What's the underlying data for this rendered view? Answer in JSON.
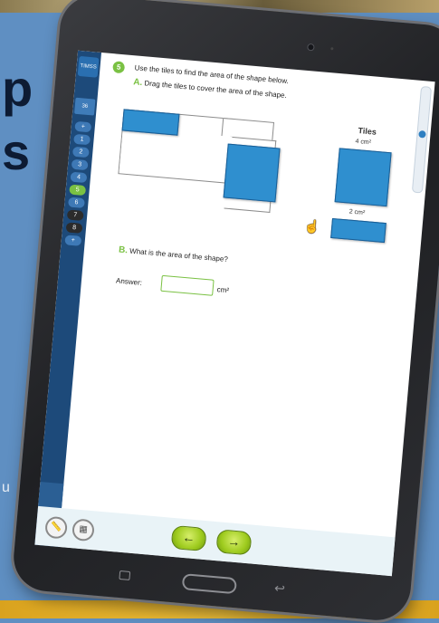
{
  "background": {
    "text_fragment_1": "p",
    "text_fragment_2": "s",
    "text_fragment_3": "u"
  },
  "sidebar": {
    "logo_text": "TIMSS",
    "logo2_text": "36",
    "items": [
      {
        "label": "+"
      },
      {
        "label": "1"
      },
      {
        "label": "2"
      },
      {
        "label": "3"
      },
      {
        "label": "4"
      },
      {
        "label": "5",
        "active": true
      },
      {
        "label": "6"
      },
      {
        "label": "7"
      },
      {
        "label": "8"
      },
      {
        "label": "+"
      }
    ]
  },
  "question": {
    "number": "5",
    "prompt": "Use the tiles to find the area of the shape below.",
    "part_a_letter": "A.",
    "part_a_text": "Drag the tiles to cover the area of the shape.",
    "tiles_title": "Tiles",
    "tile_large_label": "4 cm²",
    "tile_small_label": "2 cm²",
    "part_b_letter": "B.",
    "part_b_text": "What is the area of the shape?",
    "answer_label": "Answer:",
    "answer_value": "",
    "answer_unit": "cm²"
  },
  "footer": {
    "ruler_icon": "ruler-icon",
    "calculator_icon": "calculator-icon",
    "back_glyph": "←",
    "next_glyph": "→"
  },
  "colors": {
    "tile": "#2f8fcf",
    "accent_green": "#7ac143",
    "sidebar": "#1d4a7a"
  }
}
